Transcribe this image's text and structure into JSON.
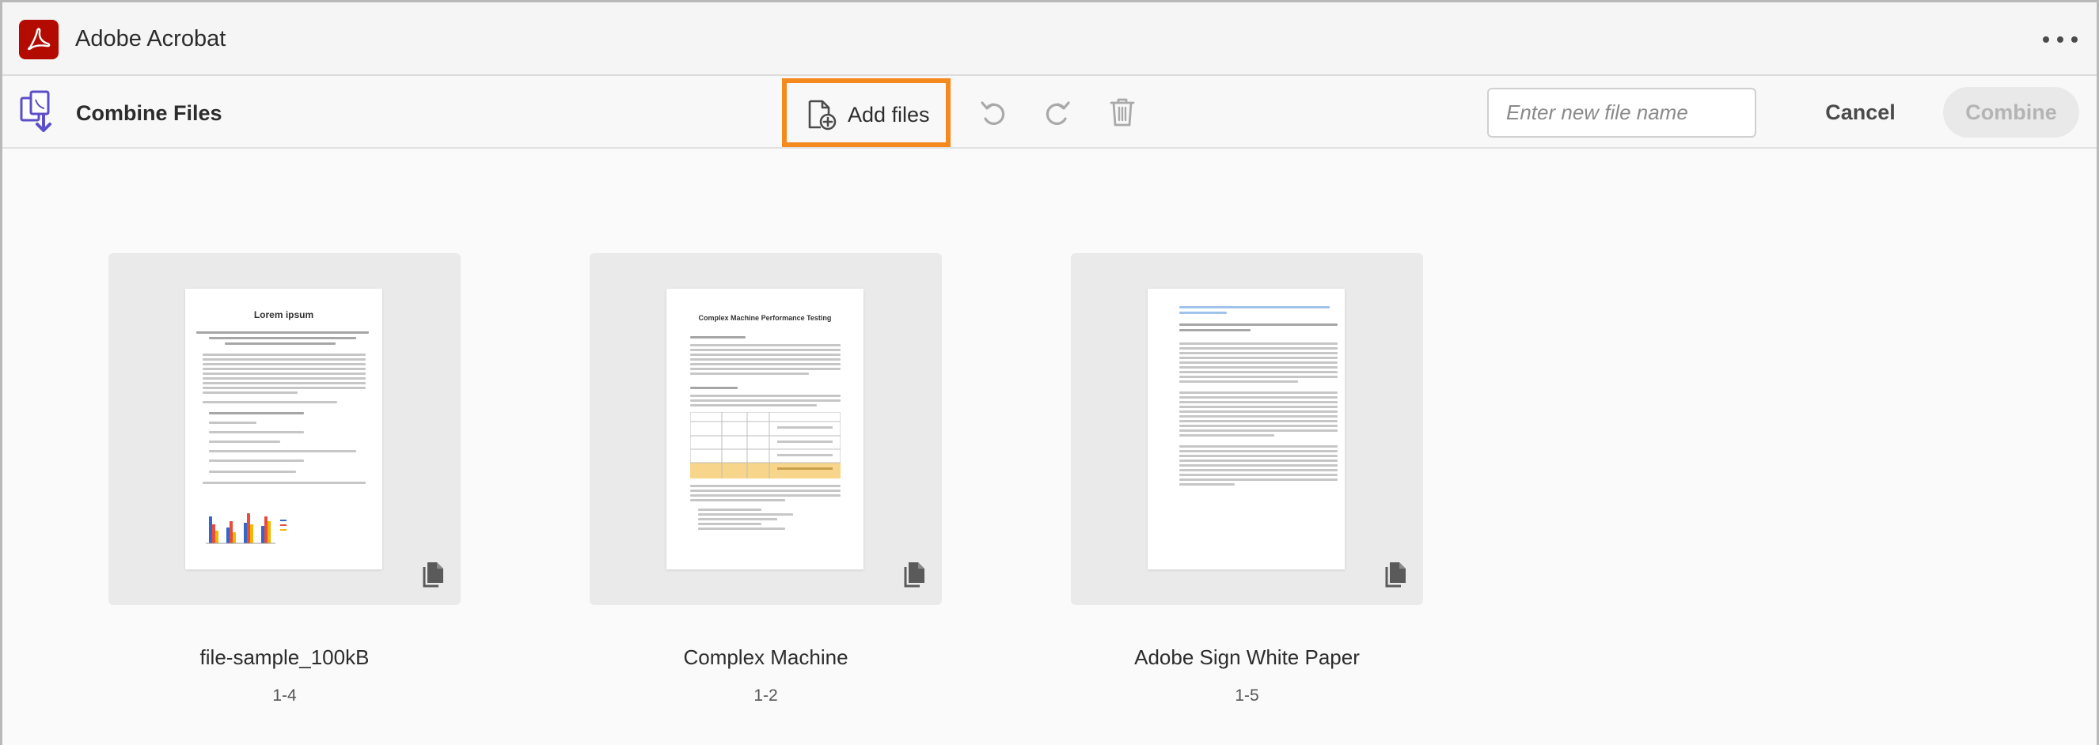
{
  "app": {
    "title": "Adobe Acrobat"
  },
  "toolbar": {
    "tool_title": "Combine Files",
    "add_files_label": "Add files",
    "filename_placeholder": "Enter new file name",
    "cancel_label": "Cancel",
    "combine_label": "Combine"
  },
  "files": [
    {
      "name": "file-sample_100kB",
      "pages": "1-4",
      "preview_title": "Lorem ipsum"
    },
    {
      "name": "Complex Machine",
      "pages": "1-2",
      "preview_title": "Complex Machine Performance Testing"
    },
    {
      "name": "Adobe Sign White Paper",
      "pages": "1-5"
    }
  ],
  "colors": {
    "brand_red": "#b30b00",
    "highlight_orange": "#f48a1d",
    "tool_purple": "#5b4fc9"
  },
  "icons": {
    "app_logo": "acrobat-logo-icon",
    "tool": "combine-files-icon",
    "add_files": "add-file-icon",
    "undo": "undo-icon",
    "redo": "redo-icon",
    "delete": "trash-icon",
    "more": "more-icon",
    "page_stack": "page-stack-icon"
  }
}
